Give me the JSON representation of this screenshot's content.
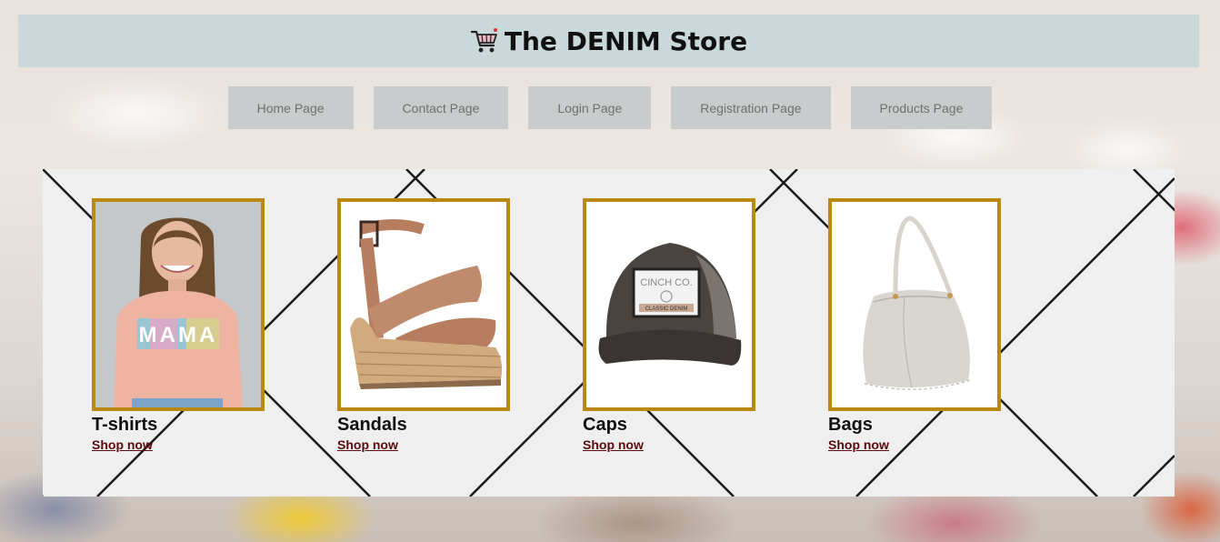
{
  "header": {
    "title": "The DENIM Store",
    "icon": "shopping-cart-icon"
  },
  "nav": {
    "items": [
      {
        "label": "Home Page"
      },
      {
        "label": "Contact Page"
      },
      {
        "label": "Login Page"
      },
      {
        "label": "Registration Page"
      },
      {
        "label": "Products Page"
      }
    ]
  },
  "products": [
    {
      "name": "T-shirts",
      "link": "Shop now",
      "image": "pink-mama-tshirt-image"
    },
    {
      "name": "Sandals",
      "link": "Shop now",
      "image": "wedge-sandal-image"
    },
    {
      "name": "Caps",
      "link": "Shop now",
      "image": "trucker-cap-image"
    },
    {
      "name": "Bags",
      "link": "Shop now",
      "image": "hobo-bag-image"
    }
  ],
  "colors": {
    "header_bg": "#c9d8d8",
    "nav_bg": "#c8cccc",
    "frame_border": "#b88a12",
    "link_color": "#5a0a0a"
  }
}
